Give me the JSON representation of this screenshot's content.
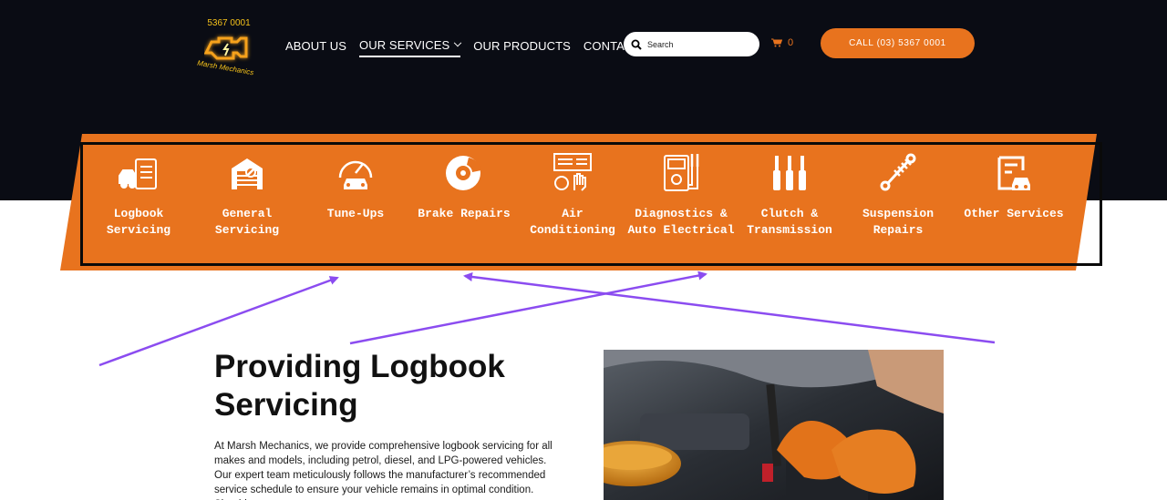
{
  "logo": {
    "phone": "5367 0001",
    "name": "Marsh Mechanics"
  },
  "nav": [
    {
      "label": "ABOUT US",
      "active": false,
      "dropdown": false
    },
    {
      "label": "OUR SERVICES",
      "active": true,
      "dropdown": true
    },
    {
      "label": "OUR PRODUCTS",
      "active": false,
      "dropdown": false
    },
    {
      "label": "CONTACT US",
      "active": false,
      "dropdown": false
    }
  ],
  "search": {
    "placeholder": "Search",
    "icon": "search-icon"
  },
  "cart": {
    "count": "0",
    "icon": "shopping-cart-icon"
  },
  "call_button": {
    "label": "CALL (03) 5367 0001"
  },
  "services": [
    {
      "label": "Logbook Servicing",
      "icon": "logbook-icon"
    },
    {
      "label": "General Servicing",
      "icon": "garage-wrench-icon"
    },
    {
      "label": "Tune-Ups",
      "icon": "speedometer-car-icon"
    },
    {
      "label": "Brake Repairs",
      "icon": "brake-disc-icon"
    },
    {
      "label": "Air Conditioning",
      "icon": "air-conditioning-icon"
    },
    {
      "label": "Diagnostics & Auto Electrical",
      "icon": "multimeter-icon"
    },
    {
      "label": "Clutch & Transmission",
      "icon": "gear-shift-icon"
    },
    {
      "label": "Suspension Repairs",
      "icon": "shock-absorber-icon"
    },
    {
      "label": "Other Services",
      "icon": "document-car-icon"
    }
  ],
  "content": {
    "title": "Providing Logbook Servicing",
    "body": "At Marsh Mechanics, we provide comprehensive logbook servicing for all makes and models, including petrol, diesel, and LPG-powered vehicles. Our expert team meticulously follows the manufacturer’s recommended service schedule to ensure your vehicle remains in optimal condition. Should we"
  },
  "colors": {
    "accent": "#e8731e",
    "dark_bg": "#0a0c14",
    "annotation_arrow": "#8b4cf0",
    "logo_yellow": "#f6c21a"
  }
}
